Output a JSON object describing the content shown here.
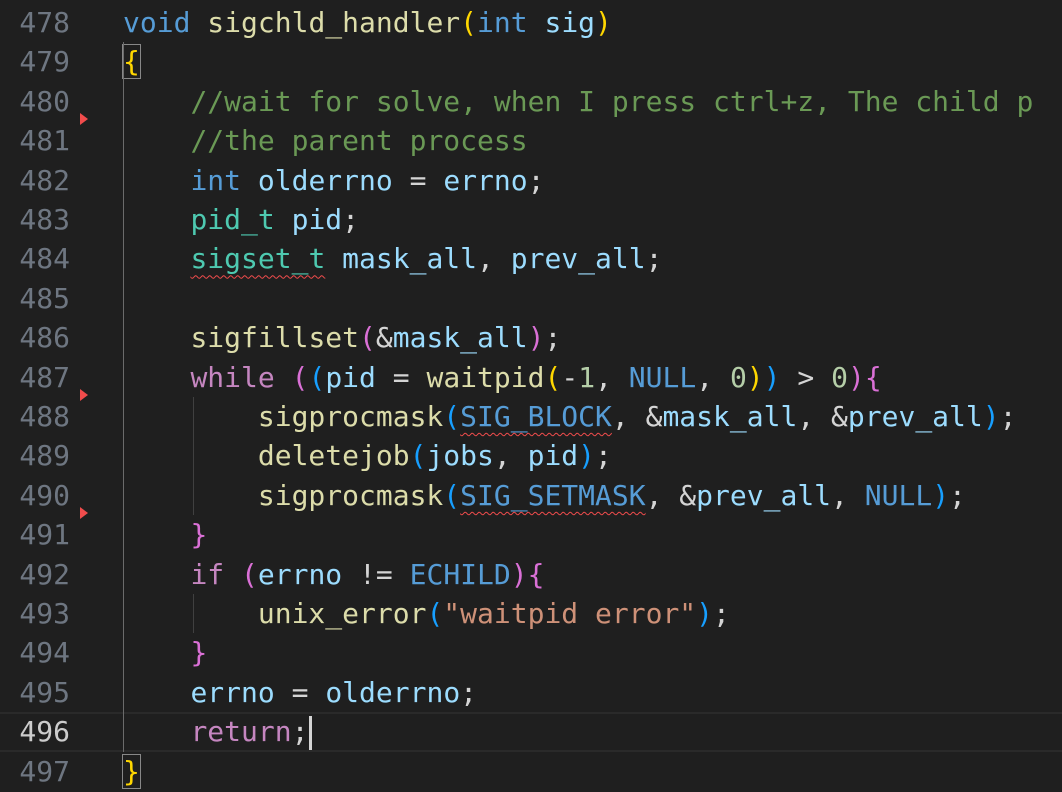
{
  "editor": {
    "lines": [
      {
        "num": "478",
        "tokens": [
          [
            "kw",
            "void"
          ],
          [
            "pl",
            " "
          ],
          [
            "fn",
            "sigchld_handler"
          ],
          [
            "b1",
            "("
          ],
          [
            "kw",
            "int"
          ],
          [
            "pl",
            " "
          ],
          [
            "var",
            "sig"
          ],
          [
            "b1",
            ")"
          ]
        ]
      },
      {
        "num": "479",
        "tokens": [
          [
            "b1box",
            "{"
          ]
        ]
      },
      {
        "num": "480",
        "tokens": [
          [
            "pl",
            "    "
          ],
          [
            "cm",
            "//wait for solve, when I press ctrl+z, The child p"
          ]
        ]
      },
      {
        "num": "481",
        "marker": true,
        "tokens": [
          [
            "pl",
            "    "
          ],
          [
            "cm",
            "//the parent process"
          ]
        ]
      },
      {
        "num": "482",
        "tokens": [
          [
            "pl",
            "    "
          ],
          [
            "kw",
            "int"
          ],
          [
            "pl",
            " "
          ],
          [
            "var",
            "olderrno"
          ],
          [
            "pl",
            " = "
          ],
          [
            "var",
            "errno"
          ],
          [
            "pl",
            ";"
          ]
        ]
      },
      {
        "num": "483",
        "tokens": [
          [
            "pl",
            "    "
          ],
          [
            "ty",
            "pid_t"
          ],
          [
            "pl",
            " "
          ],
          [
            "var",
            "pid"
          ],
          [
            "pl",
            ";"
          ]
        ]
      },
      {
        "num": "484",
        "tokens": [
          [
            "pl",
            "    "
          ],
          [
            "tyerr",
            "sigset_t"
          ],
          [
            "pl",
            " "
          ],
          [
            "var",
            "mask_all"
          ],
          [
            "pl",
            ", "
          ],
          [
            "var",
            "prev_all"
          ],
          [
            "pl",
            ";"
          ]
        ]
      },
      {
        "num": "485",
        "tokens": []
      },
      {
        "num": "486",
        "tokens": [
          [
            "pl",
            "    "
          ],
          [
            "fn",
            "sigfillset"
          ],
          [
            "b2",
            "("
          ],
          [
            "pl",
            "&"
          ],
          [
            "var",
            "mask_all"
          ],
          [
            "b2",
            ")"
          ],
          [
            "pl",
            ";"
          ]
        ]
      },
      {
        "num": "487",
        "tokens": [
          [
            "pl",
            "    "
          ],
          [
            "ctl",
            "while"
          ],
          [
            "pl",
            " "
          ],
          [
            "b2",
            "("
          ],
          [
            "b3",
            "("
          ],
          [
            "var",
            "pid"
          ],
          [
            "pl",
            " = "
          ],
          [
            "fn",
            "waitpid"
          ],
          [
            "b1",
            "("
          ],
          [
            "pl",
            "-"
          ],
          [
            "nu",
            "1"
          ],
          [
            "pl",
            ", "
          ],
          [
            "mc",
            "NULL"
          ],
          [
            "pl",
            ", "
          ],
          [
            "nu",
            "0"
          ],
          [
            "b1",
            ")"
          ],
          [
            "b3",
            ")"
          ],
          [
            "pl",
            " > "
          ],
          [
            "nu",
            "0"
          ],
          [
            "b2",
            ")"
          ],
          [
            "b2",
            "{"
          ]
        ]
      },
      {
        "num": "488",
        "marker": true,
        "tokens": [
          [
            "pl",
            "        "
          ],
          [
            "fn",
            "sigprocmask"
          ],
          [
            "b3",
            "("
          ],
          [
            "mcerr",
            "SIG_BLOCK"
          ],
          [
            "pl",
            ", &"
          ],
          [
            "var",
            "mask_all"
          ],
          [
            "pl",
            ", &"
          ],
          [
            "var",
            "prev_all"
          ],
          [
            "b3",
            ")"
          ],
          [
            "pl",
            ";"
          ]
        ]
      },
      {
        "num": "489",
        "tokens": [
          [
            "pl",
            "        "
          ],
          [
            "fn",
            "deletejob"
          ],
          [
            "b3",
            "("
          ],
          [
            "var",
            "jobs"
          ],
          [
            "pl",
            ", "
          ],
          [
            "var",
            "pid"
          ],
          [
            "b3",
            ")"
          ],
          [
            "pl",
            ";"
          ]
        ]
      },
      {
        "num": "490",
        "tokens": [
          [
            "pl",
            "        "
          ],
          [
            "fn",
            "sigprocmask"
          ],
          [
            "b3",
            "("
          ],
          [
            "mcerr",
            "SIG_SETMASK"
          ],
          [
            "pl",
            ", &"
          ],
          [
            "var",
            "prev_all"
          ],
          [
            "pl",
            ", "
          ],
          [
            "mc",
            "NULL"
          ],
          [
            "b3",
            ")"
          ],
          [
            "pl",
            ";"
          ]
        ]
      },
      {
        "num": "491",
        "marker": true,
        "tokens": [
          [
            "pl",
            "    "
          ],
          [
            "b2",
            "}"
          ]
        ]
      },
      {
        "num": "492",
        "tokens": [
          [
            "pl",
            "    "
          ],
          [
            "ctl",
            "if"
          ],
          [
            "pl",
            " "
          ],
          [
            "b2",
            "("
          ],
          [
            "var",
            "errno"
          ],
          [
            "pl",
            " != "
          ],
          [
            "mc",
            "ECHILD"
          ],
          [
            "b2",
            ")"
          ],
          [
            "b2",
            "{"
          ]
        ]
      },
      {
        "num": "493",
        "tokens": [
          [
            "pl",
            "        "
          ],
          [
            "fn",
            "unix_error"
          ],
          [
            "b3",
            "("
          ],
          [
            "st",
            "\"waitpid error\""
          ],
          [
            "b3",
            ")"
          ],
          [
            "pl",
            ";"
          ]
        ]
      },
      {
        "num": "494",
        "tokens": [
          [
            "pl",
            "    "
          ],
          [
            "b2",
            "}"
          ]
        ]
      },
      {
        "num": "495",
        "tokens": [
          [
            "pl",
            "    "
          ],
          [
            "var",
            "errno"
          ],
          [
            "pl",
            " = "
          ],
          [
            "var",
            "olderrno"
          ],
          [
            "pl",
            ";"
          ]
        ]
      },
      {
        "num": "496",
        "current": true,
        "tokens": [
          [
            "pl",
            "    "
          ],
          [
            "ctl",
            "return"
          ],
          [
            "pl",
            ";"
          ]
        ]
      },
      {
        "num": "497",
        "tokens": [
          [
            "b1box",
            "}"
          ]
        ]
      }
    ]
  }
}
